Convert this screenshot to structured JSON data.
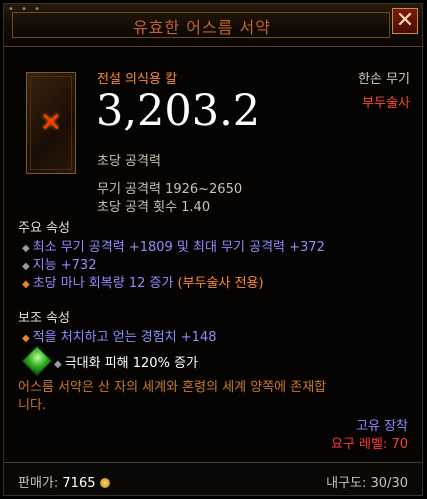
{
  "header": {
    "title": "유효한 어스름 서약",
    "close_label": "✕",
    "dots": "• • •"
  },
  "item": {
    "rarity_type": "전설 의식용 칼",
    "hand": "한손 무기",
    "class_restriction": "부두술사",
    "damage_value": "3,203.2",
    "damage_label": "초당 공격력",
    "weapon_damage": "무기 공격력 1926~2650",
    "attack_speed": "초당 공격 횟수 1.40"
  },
  "primary": {
    "label": "주요 속성",
    "stats": [
      {
        "text": "최소 무기 공격력 +1809 및 최대 무기 공격력 +372"
      },
      {
        "text": "지능 +732"
      },
      {
        "text": "초당 마나 회복량 12 증가"
      }
    ],
    "mana_suffix": " (부두술사 전용)"
  },
  "secondary": {
    "label": "보조 속성",
    "stats": [
      {
        "text": "적을 처치하고 얻는 경험치 +148"
      }
    ]
  },
  "gem": {
    "text": "극대화 피해 120% 증가"
  },
  "flavor": {
    "line1": "어스름 서약은 산 자의 세계와 혼령의 세계 양쪽에 존재합",
    "line2": "니다."
  },
  "binding": {
    "account_bound": "고유 장착",
    "required_level": "요구 레벨: 70"
  },
  "footer": {
    "sell_label": "판매가:",
    "sell_value": "7165",
    "durability": "내구도: 30/30"
  },
  "colors": {
    "legendary": "#ff8a2c",
    "magic": "#8d8dff",
    "gem": "#2fc21a"
  }
}
